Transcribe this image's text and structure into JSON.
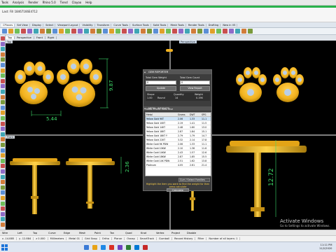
{
  "menu": [
    "Tools",
    "Analysis",
    "Render",
    "Rhino 5.0",
    "Tiend",
    "Clayoo",
    "Help"
  ],
  "command_lines": [
    "Last: Fill 18467166E4712",
    ""
  ],
  "toolbar_tabs": [
    "CPlanes",
    "Set View",
    "Display",
    "Select",
    "Viewport Layout",
    "Visibility",
    "Transform",
    "Curve Tools",
    "Surface Tools",
    "Solid Tools",
    "Mesh Tools",
    "Render Tools",
    "Drafting",
    "New in V5"
  ],
  "view_tabs": [
    "Top",
    "Perspective",
    "Front",
    "Right"
  ],
  "viewport_labels": {
    "top": "Top",
    "perspective": "Perspective",
    "front": "Front",
    "right": "Right"
  },
  "dimensions": {
    "top_width": "5.44",
    "top_height": "9.87",
    "front_height": "2.36",
    "front_total": "12.72"
  },
  "panel": {
    "gem_section": "GEM REPORTER",
    "total_gem_weight_label": "Total Gem Weight",
    "total_gem_count_label": "Total Gem Count",
    "total_gem_weight": "0",
    "total_gem_count": "0",
    "update_label": "Update",
    "view_report_label": "View Report",
    "shape_header": "Shape",
    "quantity_header": "Quantity",
    "weight_header": "Weight",
    "gem_rows": [
      {
        "q": "1.00",
        "s": "Round",
        "n": "14",
        "w": "0.196"
      }
    ],
    "metal_section": "METAL WEIGHTS",
    "metal_subtitle": "Metal Prices: View Hise",
    "metal_headers": [
      "Metal",
      "Grams",
      "DWT",
      "SPG"
    ],
    "metals": [
      [
        "Yellow Gold 9KT",
        "2.06",
        "1.33",
        "11.1"
      ],
      [
        "Yellow Gold 10KT",
        "2.19",
        "1.41",
        "11.5"
      ],
      [
        "Yellow Gold 14KT",
        "2.48",
        "1.60",
        "13.0"
      ],
      [
        "Yellow Gold 18KT",
        "2.87",
        "1.84",
        "15.1"
      ],
      [
        "Yellow Gold 18KT Y",
        "2.79",
        "1.79",
        "14.7"
      ],
      [
        "Yellow Gold 22KT",
        "3.32",
        "2.14",
        "17.8"
      ],
      [
        "White Gold 9K PDW",
        "2.06",
        "1.33",
        "11.1"
      ],
      [
        "White Gold 10KW",
        "2.10",
        "1.36",
        "11.6"
      ],
      [
        "White Gold 14KW",
        "2.43",
        "1.57",
        "12.6"
      ],
      [
        "White Gold 18KW",
        "2.87",
        "1.85",
        "15.5"
      ],
      [
        "White Gold 14K PDW",
        "2.51",
        "1.62",
        "13.8"
      ],
      [
        "Platinum",
        "4.05",
        "2.61",
        "21.4"
      ]
    ],
    "filter_label": "Curr / Select Families",
    "highlight_text": "Highlight the item you want to find the weight for then press calculate",
    "calculate_label": "Calculate"
  },
  "status": {
    "items": [
      "Wire",
      "Left",
      "Top",
      "Curve",
      "Edge",
      "Mesh",
      "Point",
      "Tan",
      "Quad",
      "Knot",
      "Vertex",
      "Project",
      "Disable"
    ]
  },
  "coords": [
    "x -14.885",
    "y -12.884",
    "z 0.000",
    "Millimeters",
    "Metal 01",
    "Grid Snap",
    "Ortho",
    "Planar",
    "Osnap",
    "SmartTrack",
    "Gumball",
    "Record History",
    "Filter",
    "Number of all layers: 1"
  ],
  "watermark": {
    "title": "Activate Windows",
    "subtitle": "Go to Settings to activate Windows."
  },
  "clock": {
    "time": "11:11 PM",
    "date": "11/2/2020"
  },
  "colors": {
    "gold": "#f2b21e",
    "gold_dark": "#a77a0e",
    "gem": "#b9cfe8",
    "dim": "#3fdc6a",
    "panel": "#3d3d3d"
  }
}
